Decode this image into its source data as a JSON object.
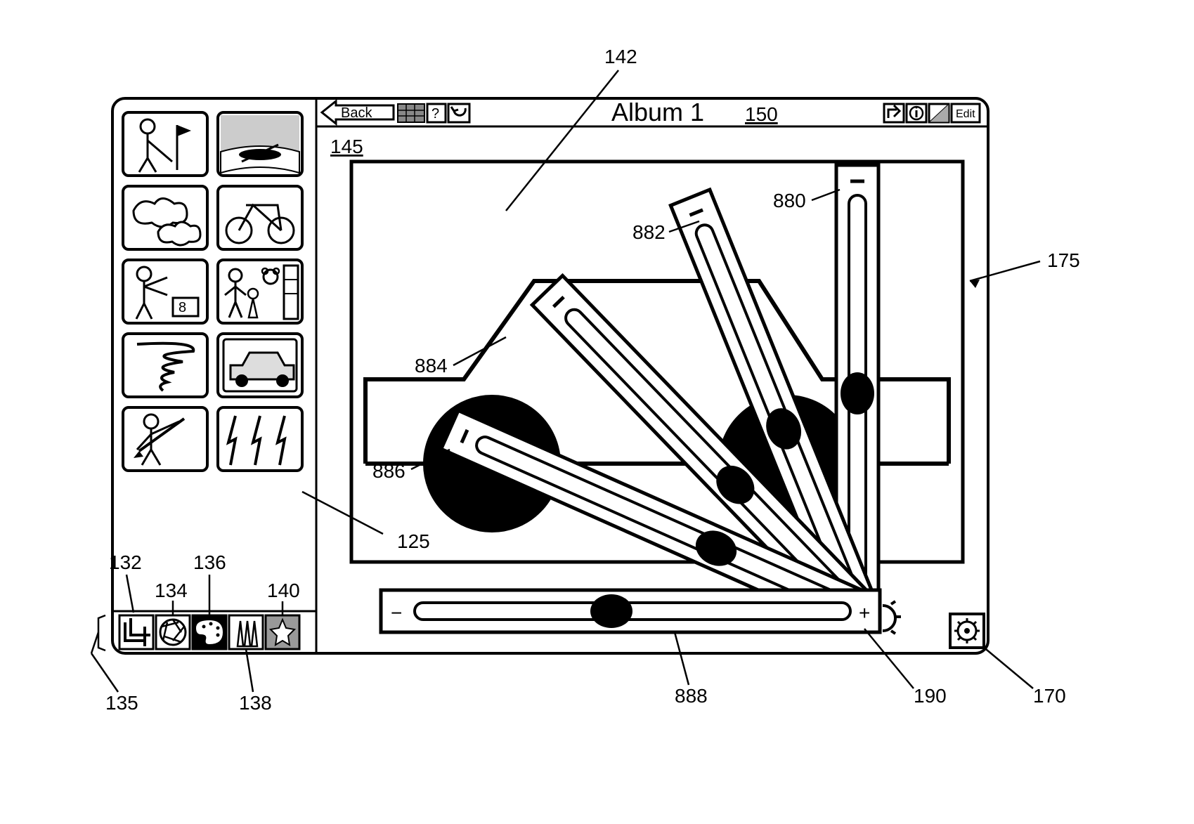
{
  "header": {
    "back_label": "Back",
    "title": "Album 1",
    "edit_label": "Edit"
  },
  "refs": {
    "r142": "142",
    "r145": "145",
    "r150": "150",
    "r175": "175",
    "r880": "880",
    "r882": "882",
    "r884": "884",
    "r886": "886",
    "r888": "888",
    "r125": "125",
    "r132": "132",
    "r134": "134",
    "r135": "135",
    "r136": "136",
    "r138": "138",
    "r140": "140",
    "r170": "170",
    "r190": "190"
  },
  "slider": {
    "minus": "−",
    "plus": "+"
  }
}
